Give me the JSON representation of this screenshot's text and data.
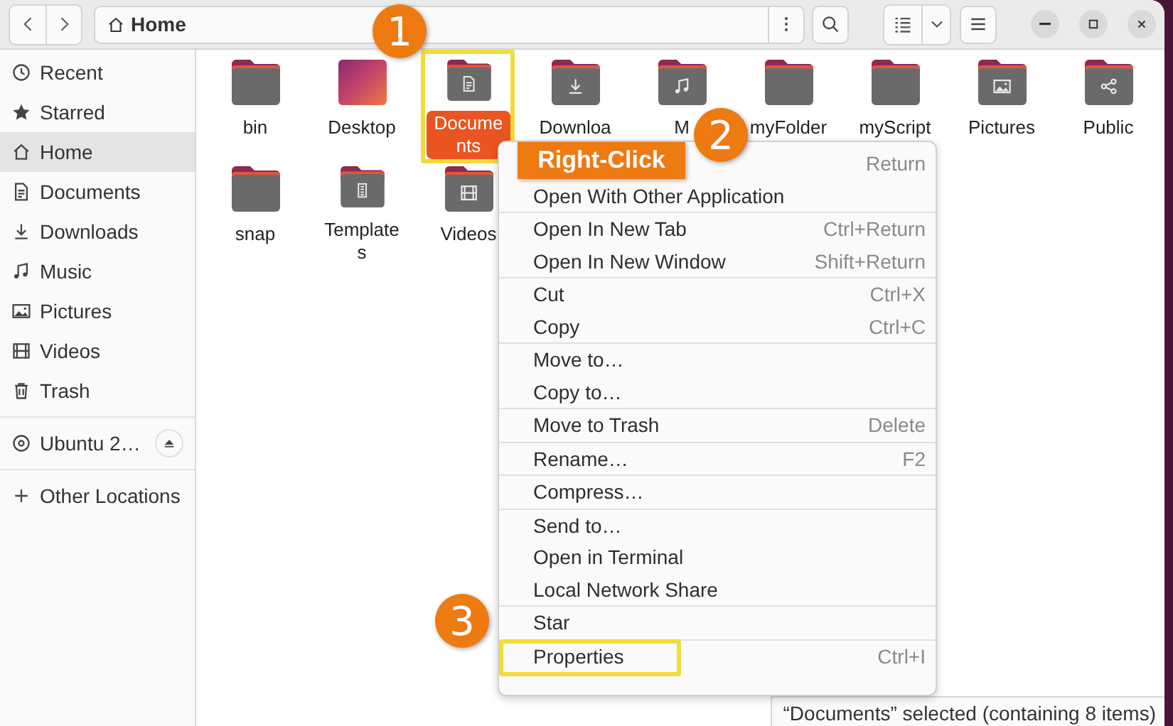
{
  "header": {
    "location": "Home"
  },
  "sidebar": {
    "sections": [
      [
        {
          "label": "Recent",
          "kind": "recent",
          "selected": false
        },
        {
          "label": "Starred",
          "kind": "starred",
          "selected": false
        },
        {
          "label": "Home",
          "kind": "home",
          "selected": true
        },
        {
          "label": "Documents",
          "kind": "documents",
          "selected": false
        },
        {
          "label": "Downloads",
          "kind": "downloads",
          "selected": false
        },
        {
          "label": "Music",
          "kind": "music",
          "selected": false
        },
        {
          "label": "Pictures",
          "kind": "pictures",
          "selected": false
        },
        {
          "label": "Videos",
          "kind": "videos",
          "selected": false
        },
        {
          "label": "Trash",
          "kind": "trash",
          "selected": false
        }
      ],
      [
        {
          "label": "Ubuntu 2…",
          "kind": "drive",
          "selected": false
        }
      ],
      [
        {
          "label": "Other Locations",
          "kind": "other",
          "selected": false
        }
      ]
    ]
  },
  "files": [
    {
      "name": "bin",
      "kind": "plain",
      "selected": false,
      "highlighted": false
    },
    {
      "name": "Desktop",
      "kind": "desktop",
      "selected": false,
      "highlighted": false
    },
    {
      "name": "Documents",
      "kind": "documents",
      "selected": true,
      "highlighted": true
    },
    {
      "name": "Downloa",
      "kind": "downloads",
      "selected": false,
      "highlighted": false
    },
    {
      "name": "M",
      "kind": "music",
      "selected": false,
      "highlighted": false
    },
    {
      "name": "myFolder",
      "kind": "plain",
      "selected": false,
      "highlighted": false
    },
    {
      "name": "myScript",
      "kind": "plain",
      "selected": false,
      "highlighted": false
    },
    {
      "name": "Pictures",
      "kind": "pictures",
      "selected": false,
      "highlighted": false
    },
    {
      "name": "Public",
      "kind": "public",
      "selected": false,
      "highlighted": false
    },
    {
      "name": "snap",
      "kind": "plain",
      "selected": false,
      "highlighted": false
    },
    {
      "name": "Templates",
      "kind": "templates",
      "selected": false,
      "highlighted": false
    },
    {
      "name": "Videos",
      "kind": "videos",
      "selected": false,
      "highlighted": false
    }
  ],
  "context_menu": {
    "sections": [
      [
        {
          "shortcut": "Return",
          "highlighted": false
        },
        {
          "label": "Open With Other Application",
          "highlighted": false
        }
      ],
      [
        {
          "label": "Open In New Tab",
          "shortcut": "Ctrl+Return",
          "highlighted": false
        },
        {
          "label": "Open In New Window",
          "shortcut": "Shift+Return",
          "highlighted": false
        }
      ],
      [
        {
          "label": "Cut",
          "shortcut": "Ctrl+X",
          "highlighted": false
        },
        {
          "label": "Copy",
          "shortcut": "Ctrl+C",
          "highlighted": false
        }
      ],
      [
        {
          "label": "Move to…",
          "highlighted": false
        },
        {
          "label": "Copy to…",
          "highlighted": false
        }
      ],
      [
        {
          "label": "Move to Trash",
          "shortcut": "Delete",
          "highlighted": false
        }
      ],
      [
        {
          "label": "Rename…",
          "shortcut": "F2",
          "highlighted": false
        }
      ],
      [
        {
          "label": "Compress…",
          "highlighted": false
        }
      ],
      [
        {
          "label": "Send to…",
          "highlighted": false
        },
        {
          "label": "Open in Terminal",
          "highlighted": false
        },
        {
          "label": "Local Network Share",
          "highlighted": false
        }
      ],
      [
        {
          "label": "Star",
          "highlighted": false
        }
      ],
      [
        {
          "label": "Properties",
          "shortcut": "Ctrl+I",
          "highlighted": true
        }
      ]
    ]
  },
  "status_bar": {
    "text": "“Documents” selected (containing 8 items)"
  },
  "annotations": {
    "callouts": [
      "1",
      "2",
      "3"
    ],
    "tag": "Right-Click"
  }
}
